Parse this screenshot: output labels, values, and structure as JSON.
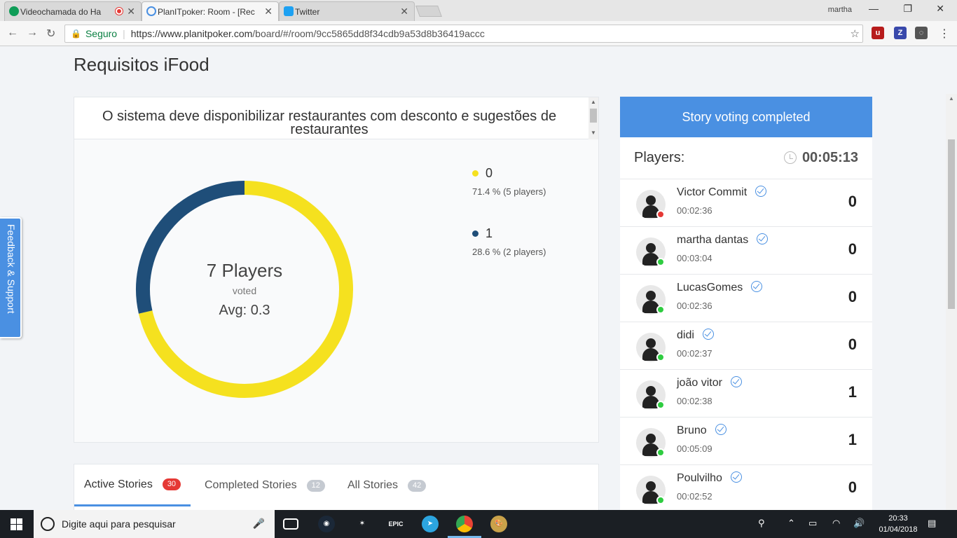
{
  "browser": {
    "tabs": [
      {
        "title": "Videochamada do Ha",
        "favicon_color": "#0f9d58"
      },
      {
        "title": "PlanITpoker: Room - [Rec",
        "favicon_color": "#4a90e2"
      },
      {
        "title": "Twitter",
        "favicon_color": "#1da1f2"
      }
    ],
    "window_user": "martha",
    "secure_label": "Seguro",
    "url_host": "https://www.planitpoker.com",
    "url_path": "/board/#/room/9cc5865dd8f34cdb9a53d8b36419accc"
  },
  "room": {
    "title": "Requisitos iFood",
    "story_title": "O sistema deve disponibilizar restaurantes com desconto e sugestões de restaurantes",
    "summary": {
      "players": "7 Players",
      "voted_label": "voted",
      "avg": "Avg: 0.3"
    },
    "feedback_label": "Feedback & Support"
  },
  "chart_data": {
    "type": "pie",
    "donut": true,
    "slices": [
      {
        "label": "0",
        "value": 71.4,
        "players": 5,
        "color": "#f5e11f",
        "pct_text": "71.4 % (5 players)"
      },
      {
        "label": "1",
        "value": 28.6,
        "players": 2,
        "color": "#1f4e79",
        "pct_text": "28.6 % (2 players)"
      }
    ]
  },
  "stories_tabs": [
    {
      "label": "Active Stories",
      "count": "30"
    },
    {
      "label": "Completed Stories",
      "count": "12"
    },
    {
      "label": "All Stories",
      "count": "42"
    }
  ],
  "panel": {
    "header": "Story voting completed",
    "players_label": "Players:",
    "timer": "00:05:13",
    "players": [
      {
        "name": "Victor Commit",
        "time": "00:02:36",
        "vote": "0",
        "status": "#e53935"
      },
      {
        "name": "martha dantas",
        "time": "00:03:04",
        "vote": "0",
        "status": "#2ecc40"
      },
      {
        "name": "LucasGomes",
        "time": "00:02:36",
        "vote": "0",
        "status": "#2ecc40"
      },
      {
        "name": "didi",
        "time": "00:02:37",
        "vote": "0",
        "status": "#2ecc40"
      },
      {
        "name": "joão vitor",
        "time": "00:02:38",
        "vote": "1",
        "status": "#2ecc40"
      },
      {
        "name": "Bruno",
        "time": "00:05:09",
        "vote": "1",
        "status": "#2ecc40"
      },
      {
        "name": "Poulvilho",
        "time": "00:02:52",
        "vote": "0",
        "status": "#2ecc40"
      }
    ]
  },
  "taskbar": {
    "search_placeholder": "Digite aqui para pesquisar",
    "time": "20:33",
    "date": "01/04/2018",
    "epic_label": "EPIC"
  }
}
